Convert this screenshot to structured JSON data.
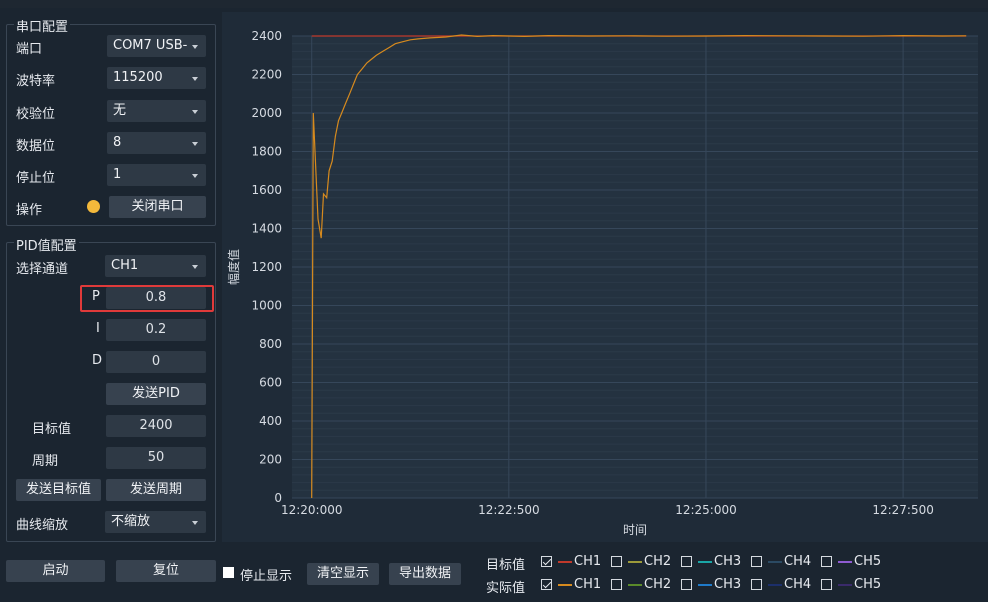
{
  "serial": {
    "title": "串口配置",
    "port": {
      "label": "端口",
      "value": "COM7 USB-"
    },
    "baud": {
      "label": "波特率",
      "value": "115200"
    },
    "parity": {
      "label": "校验位",
      "value": "无"
    },
    "databits": {
      "label": "数据位",
      "value": "8"
    },
    "stopbits": {
      "label": "停止位",
      "value": "1"
    },
    "op": {
      "label": "操作",
      "button": "关闭串口",
      "status_color": "#f4b93b"
    }
  },
  "pid": {
    "title": "PID值配置",
    "channel": {
      "label": "选择通道",
      "value": "CH1"
    },
    "p": {
      "label": "P",
      "value": "0.8"
    },
    "i": {
      "label": "I",
      "value": "0.2"
    },
    "d": {
      "label": "D",
      "value": "0"
    },
    "send_pid": "发送PID",
    "target": {
      "label": "目标值",
      "value": "2400"
    },
    "period": {
      "label": "周期",
      "value": "50"
    },
    "send_target": "发送目标值",
    "send_period": "发送周期",
    "zoom": {
      "label": "曲线缩放",
      "value": "不缩放"
    }
  },
  "bottom": {
    "start": "启动",
    "reset": "复位",
    "stop_display": "停止显示",
    "clear_display": "清空显示",
    "export": "导出数据"
  },
  "legend": {
    "target_label": "目标值",
    "actual_label": "实际值",
    "channels": [
      "CH1",
      "CH2",
      "CH3",
      "CH4",
      "CH5"
    ],
    "target_checked": [
      true,
      false,
      false,
      false,
      false
    ],
    "actual_checked": [
      true,
      false,
      false,
      false,
      false
    ],
    "target_colors": [
      "#c0392b",
      "#9c9a3a",
      "#1aa6a6",
      "#2b4a63",
      "#8e5bd1"
    ],
    "actual_colors": [
      "#d68a1e",
      "#5a8a2a",
      "#1f7ac9",
      "#1c2f6b",
      "#3a2a6b"
    ]
  },
  "chart_data": {
    "type": "line",
    "xlabel": "时间",
    "ylabel": "幅度值",
    "ylim": [
      0,
      2400
    ],
    "yticks": [
      "0",
      "200",
      "400",
      "600",
      "800",
      "1000",
      "1200",
      "1400",
      "1600",
      "1800",
      "2000",
      "2200",
      "2400"
    ],
    "xticks": [
      "12:20:000",
      "12:22:500",
      "12:25:000",
      "12:27:500"
    ],
    "grid": true,
    "series": [
      {
        "name": "CH1",
        "color": "#c0392b",
        "x": [
          0.0,
          8.3
        ],
        "values": [
          2400,
          2400
        ]
      },
      {
        "name": "CH1",
        "color": "#d68a1e",
        "x": [
          0.0,
          0.02,
          0.08,
          0.12,
          0.15,
          0.19,
          0.22,
          0.26,
          0.3,
          0.34,
          0.38,
          0.43,
          0.48,
          0.53,
          0.58,
          0.64,
          0.7,
          0.76,
          0.82,
          0.9,
          0.98,
          1.06,
          1.15,
          1.25,
          1.35,
          1.5,
          1.7,
          1.9,
          2.1,
          2.3,
          2.5,
          2.7,
          3.0,
          3.5,
          4.0,
          4.5,
          5.0,
          5.5,
          6.0,
          6.5,
          7.0,
          7.5,
          8.0,
          8.3
        ],
        "values": [
          0,
          2000,
          1450,
          1350,
          1580,
          1560,
          1700,
          1750,
          1880,
          1960,
          2000,
          2050,
          2100,
          2150,
          2200,
          2230,
          2260,
          2280,
          2300,
          2320,
          2340,
          2360,
          2370,
          2380,
          2385,
          2390,
          2395,
          2405,
          2398,
          2402,
          2400,
          2398,
          2402,
          2400,
          2401,
          2399,
          2400,
          2402,
          2401,
          2400,
          2399,
          2402,
          2400,
          2401
        ]
      }
    ]
  }
}
